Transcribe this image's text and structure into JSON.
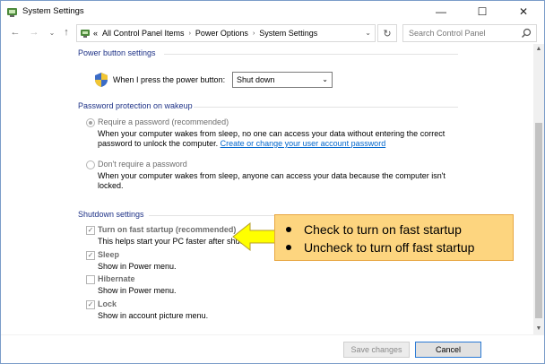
{
  "window": {
    "title": "System Settings",
    "minimize_glyph": "—",
    "maximize_glyph": "☐",
    "close_glyph": "✕"
  },
  "nav": {
    "back_glyph": "←",
    "forward_glyph": "→",
    "recent_glyph": "⌄",
    "up_glyph": "↑",
    "crumb_overflow": "«",
    "breadcrumbs": [
      "All Control Panel Items",
      "Power Options",
      "System Settings"
    ],
    "search_placeholder": "Search Control Panel"
  },
  "power_button": {
    "heading": "Power button settings",
    "label": "When I press the power button:",
    "value": "Shut down"
  },
  "password": {
    "heading": "Password protection on wakeup",
    "require": {
      "label": "Require a password (recommended)",
      "checked": true,
      "desc1": "When your computer wakes from sleep, no one can access your data without entering the correct",
      "desc2_prefix": "password to unlock the computer.",
      "link": "Create or change your user account password"
    },
    "dont": {
      "label": "Don't require a password",
      "checked": false,
      "desc1": "When your computer wakes from sleep, anyone can access your data because the computer isn't",
      "desc2": "locked."
    }
  },
  "shutdown": {
    "heading": "Shutdown settings",
    "items": [
      {
        "label": "Turn on fast startup (recommended)",
        "desc": "This helps start your PC faster after shut",
        "checked": true
      },
      {
        "label": "Sleep",
        "desc": "Show in Power menu.",
        "checked": true
      },
      {
        "label": "Hibernate",
        "desc": "Show in Power menu.",
        "checked": false
      },
      {
        "label": "Lock",
        "desc": "Show in account picture menu.",
        "checked": true
      }
    ]
  },
  "footer": {
    "save_label": "Save changes",
    "cancel_label": "Cancel"
  },
  "callout": {
    "lines": [
      "Check to turn on fast startup",
      "Uncheck to turn off fast startup"
    ]
  },
  "colors": {
    "heading": "#1e3287",
    "link": "#0066cc",
    "callout_fill": "#fdd57f",
    "arrow_fill": "#ffff00",
    "window_border": "#7a9cc9"
  },
  "icons": {
    "title": "control-panel-icon",
    "shield": "uac-shield-icon",
    "search": "search-icon",
    "refresh": "refresh-icon"
  }
}
